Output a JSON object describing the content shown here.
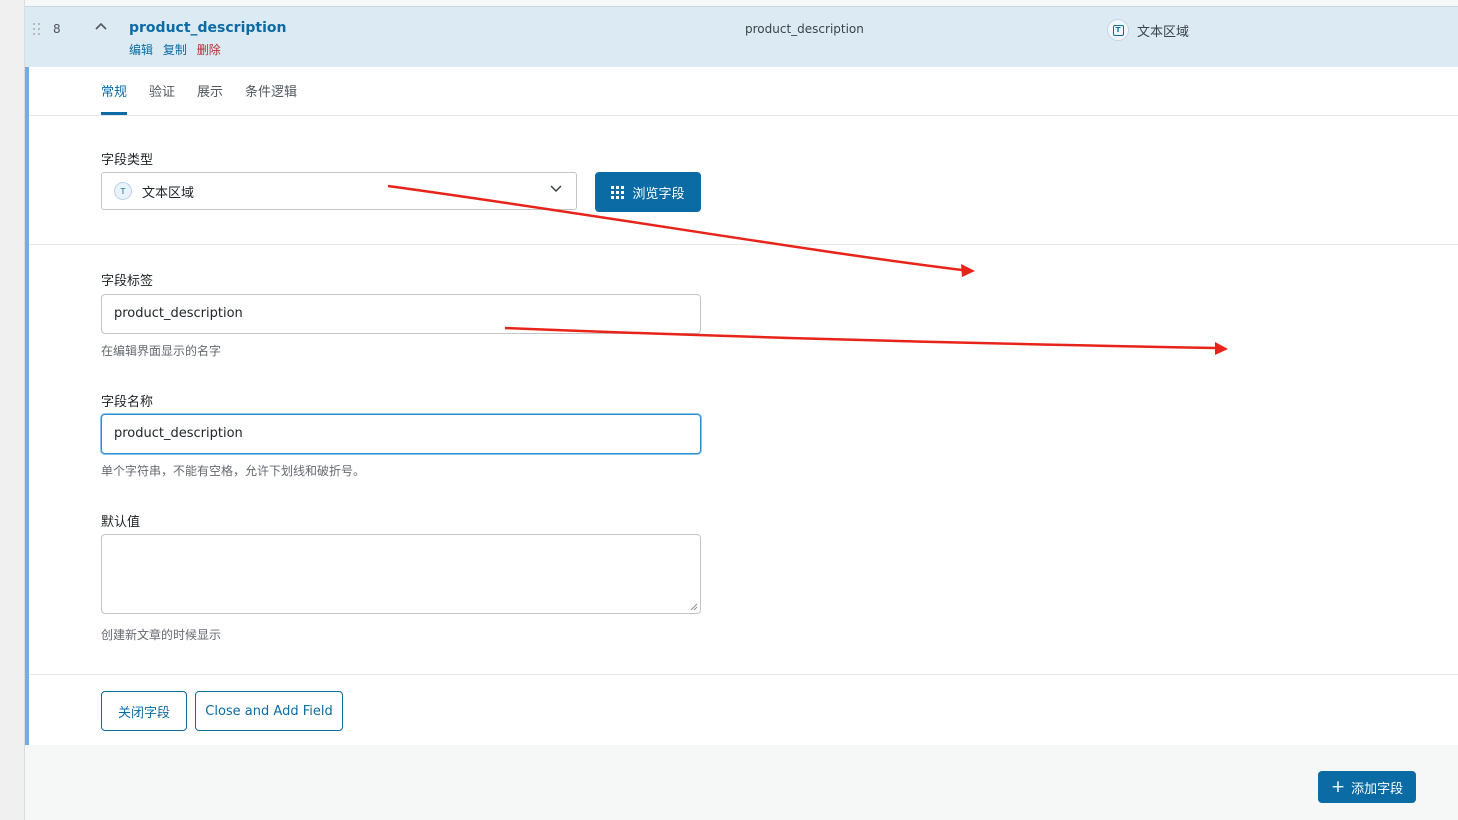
{
  "field_row": {
    "order": "8",
    "label": "product_description",
    "actions": {
      "edit": "编辑",
      "duplicate": "复制",
      "delete": "删除"
    },
    "name": "product_description",
    "type": "文本区域",
    "type_icon": "text-type-icon"
  },
  "tabs": [
    "常规",
    "验证",
    "展示",
    "条件逻辑"
  ],
  "active_tab": "常规",
  "field_type": {
    "label": "字段类型",
    "value": "文本区域",
    "browse_button": "浏览字段"
  },
  "field_label": {
    "label": "字段标签",
    "value": "product_description",
    "hint": "在编辑界面显示的名字"
  },
  "field_name": {
    "label": "字段名称",
    "value": "product_description",
    "hint": "单个字符串，不能有空格，允许下划线和破折号。"
  },
  "default_value": {
    "label": "默认值",
    "value": "",
    "hint": "创建新文章的时候显示"
  },
  "footer_buttons": {
    "close": "关闭字段",
    "close_and_add": "Close and Add Field"
  },
  "add_field_button": "添加字段",
  "colors": {
    "primary": "#0a6ba5",
    "row_highlight": "#dbeaf3",
    "delete": "#b32d2e",
    "annotation_arrow": "#e8231a"
  }
}
